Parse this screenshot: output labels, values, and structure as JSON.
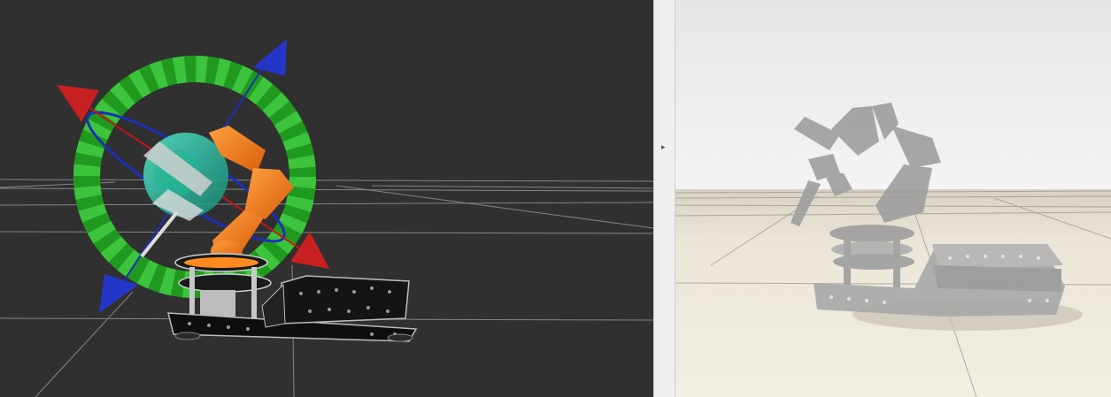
{
  "rviz": {
    "background": "#303030",
    "grid_color": "#9a9a9a",
    "marker": {
      "ring_colors": [
        "#1f9a1f",
        "#3cc43c"
      ],
      "x_axis_color": "#c01818",
      "z_axis_color": "#1c2fb8",
      "sphere_color": "#2fd4b0",
      "arm_color": "#f07a1c"
    }
  },
  "splitter": {
    "handle_glyph": "▸"
  },
  "gazebo": {
    "sky_color": "#e8e8e8",
    "floor_color": "#efe9dc",
    "model_color": "#9e9e9e",
    "shadow_color": "#c9c2b4"
  }
}
